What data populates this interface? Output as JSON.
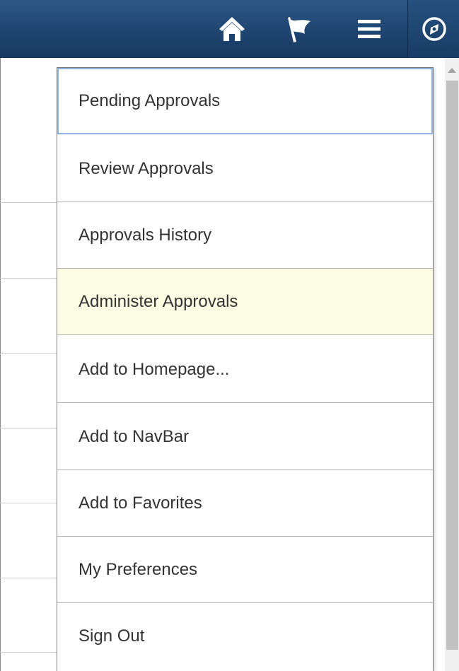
{
  "header": {
    "home_icon": "home-icon",
    "flag_icon": "flag-icon",
    "menu_icon": "hamburger-menu-icon",
    "navbar_icon": "compass-icon",
    "bg_color": "#1e4470"
  },
  "menu": {
    "items": [
      {
        "label": "Pending Approvals",
        "state": "focused"
      },
      {
        "label": "Review Approvals",
        "state": "normal"
      },
      {
        "label": "Approvals History",
        "state": "normal"
      },
      {
        "label": "Administer Approvals",
        "state": "hovered"
      },
      {
        "label": "Add to Homepage...",
        "state": "normal"
      },
      {
        "label": "Add to NavBar",
        "state": "normal"
      },
      {
        "label": "Add to Favorites",
        "state": "normal"
      },
      {
        "label": "My Preferences",
        "state": "normal"
      },
      {
        "label": "Sign Out",
        "state": "normal"
      }
    ],
    "hover_color": "#fdfde4",
    "focus_color": "#8fb2de"
  }
}
